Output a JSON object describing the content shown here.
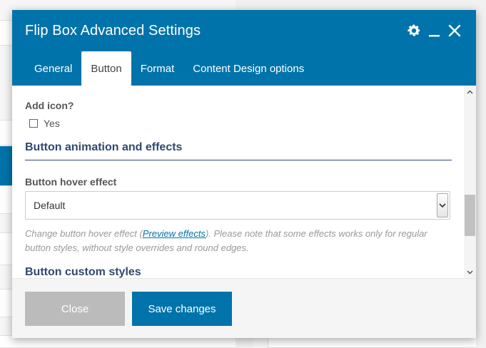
{
  "modal": {
    "title": "Flip Box Advanced Settings",
    "tabs": [
      {
        "label": "General",
        "active": false
      },
      {
        "label": "Button",
        "active": true
      },
      {
        "label": "Format",
        "active": false
      },
      {
        "label": "Content Design options",
        "active": false
      }
    ]
  },
  "fields": {
    "add_icon": {
      "label": "Add icon?",
      "checkbox_label": "Yes",
      "checked": false
    },
    "animation_section_title": "Button animation and effects",
    "hover_effect": {
      "label": "Button hover effect",
      "value": "Default",
      "help_prefix": "Change button hover effect (",
      "help_link": "Preview effects",
      "help_suffix": "). Please note that some effects works only for regular button styles, without style overrides and round edges."
    },
    "custom_styles_section_title": "Button custom styles"
  },
  "footer": {
    "close_label": "Close",
    "save_label": "Save changes"
  },
  "colors": {
    "header": "#0073aa",
    "section_title": "#2f4a6e",
    "close_button": "#bbbbbb",
    "save_button": "#0073aa"
  },
  "icons": {
    "settings": "gear-icon",
    "minimize": "minimize-icon",
    "close": "close-icon"
  }
}
